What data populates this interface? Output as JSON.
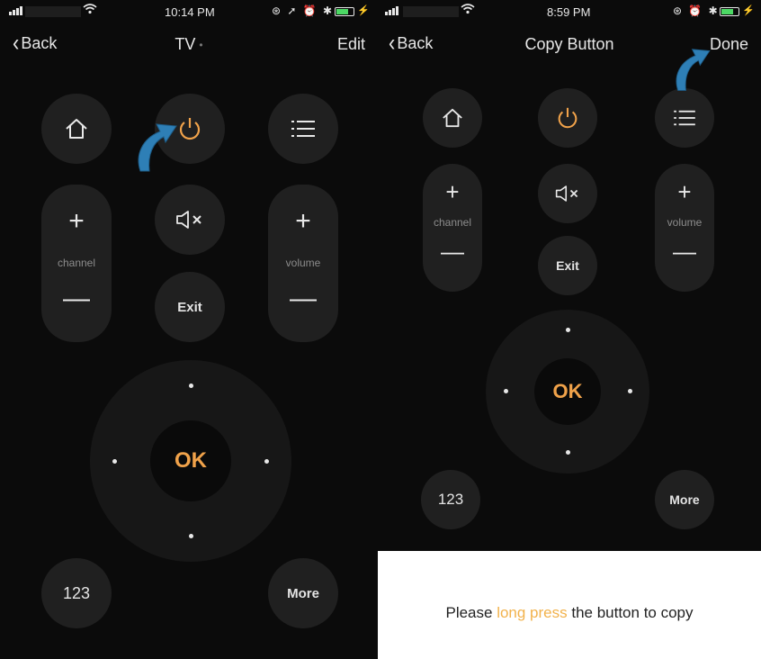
{
  "colors": {
    "accent": "#f0a24a",
    "arrow": "#2e7fb6",
    "background": "#0b0b0b",
    "button": "#202020"
  },
  "left_screen": {
    "status_bar": {
      "time": "10:14 PM",
      "wifi_icon": "wifi-icon",
      "status_icons": "⊛ ➚ ⏰ ✱"
    },
    "nav": {
      "back_label": "Back",
      "title": "TV",
      "right_label": "Edit"
    },
    "remote": {
      "home_icon": "home-icon",
      "power_icon": "power-icon",
      "menu_icon": "menu-list-icon",
      "mute_icon": "mute-icon",
      "channel_label": "channel",
      "volume_label": "volume",
      "exit_label": "Exit",
      "ok_label": "OK",
      "numpad_label": "123",
      "more_label": "More"
    }
  },
  "right_screen": {
    "status_bar": {
      "time": "8:59 PM",
      "wifi_icon": "wifi-icon",
      "status_icons": "⊛ ⏰ ✱"
    },
    "nav": {
      "back_label": "Back",
      "title": "Copy Button",
      "right_label": "Done"
    },
    "remote": {
      "channel_label": "channel",
      "volume_label": "volume",
      "exit_label": "Exit",
      "ok_label": "OK",
      "numpad_label": "123",
      "more_label": "More"
    }
  },
  "hint": {
    "before": "Please ",
    "highlight": "long press",
    "after": " the button to copy"
  }
}
